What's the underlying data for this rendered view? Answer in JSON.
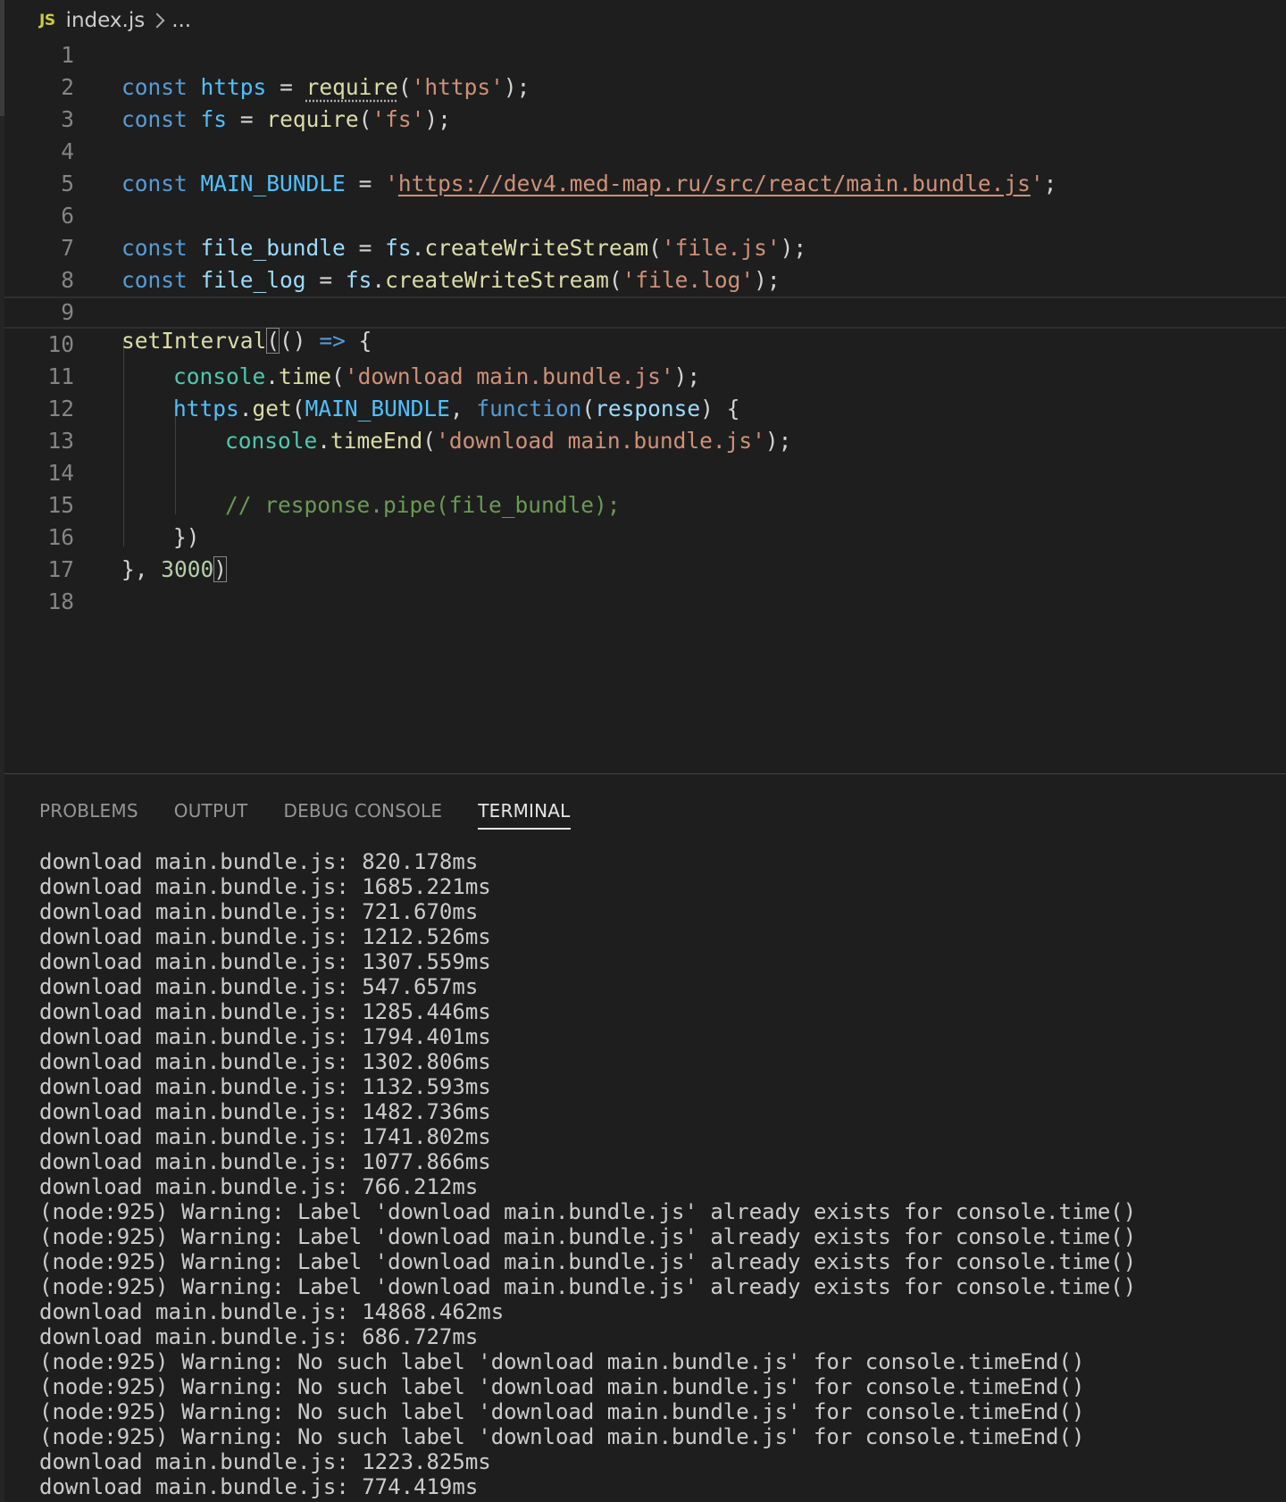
{
  "breadcrumb": {
    "file_type_icon": "JS",
    "file_name": "index.js",
    "more": "..."
  },
  "editor": {
    "line_numbers": [
      "1",
      "2",
      "3",
      "4",
      "5",
      "6",
      "7",
      "8",
      "9",
      "10",
      "11",
      "12",
      "13",
      "14",
      "15",
      "16",
      "17",
      "18"
    ],
    "line1": {
      "kw": "const",
      "name": "https",
      "eq": "=",
      "fn": "require",
      "open": "(",
      "str": "'https'",
      "close": ");"
    },
    "line2": {
      "kw": "const",
      "name": "fs",
      "eq": "=",
      "fn": "require",
      "open": "(",
      "str": "'fs'",
      "close": ");"
    },
    "line4": {
      "kw": "const",
      "name": "MAIN_BUNDLE",
      "eq": "=",
      "quote_open": "'",
      "url": "https://dev4.med-map.ru/src/react/main.bundle.js",
      "quote_close": "'",
      "end": ";"
    },
    "line6": {
      "kw": "const",
      "name": "file_bundle",
      "eq": "=",
      "obj": "fs",
      "dot": ".",
      "fn": "createWriteStream",
      "open": "(",
      "str": "'file.js'",
      "close": ");"
    },
    "line7": {
      "kw": "const",
      "name": "file_log",
      "eq": "=",
      "obj": "fs",
      "dot": ".",
      "fn": "createWriteStream",
      "open": "(",
      "str": "'file.log'",
      "close": ");"
    },
    "line9": {
      "fn": "setInterval",
      "open": "(",
      "params": "()",
      "arrow": "=>",
      "brace": "{"
    },
    "line10": {
      "obj": "console",
      "dot": ".",
      "fn": "time",
      "open": "(",
      "str": "'download main.bundle.js'",
      "close": ");"
    },
    "line11": {
      "obj": "https",
      "dot": ".",
      "fn": "get",
      "open": "(",
      "arg": "MAIN_BUNDLE",
      "comma": ",",
      "kw": "function",
      "popen": "(",
      "param": "response",
      "pclose": ")",
      "brace": "{"
    },
    "line12": {
      "obj": "console",
      "dot": ".",
      "fn": "timeEnd",
      "open": "(",
      "str": "'download main.bundle.js'",
      "close": ");"
    },
    "line14": {
      "comment": "// response.pipe(file_bundle);"
    },
    "line15": {
      "text": "})"
    },
    "line16": {
      "close": "},",
      "num": "3000",
      "paren": ")"
    }
  },
  "panel": {
    "tabs": [
      {
        "label": "PROBLEMS",
        "active": false
      },
      {
        "label": "OUTPUT",
        "active": false
      },
      {
        "label": "DEBUG CONSOLE",
        "active": false
      },
      {
        "label": "TERMINAL",
        "active": true
      }
    ],
    "terminal_lines": [
      "download main.bundle.js: 820.178ms",
      "download main.bundle.js: 1685.221ms",
      "download main.bundle.js: 721.670ms",
      "download main.bundle.js: 1212.526ms",
      "download main.bundle.js: 1307.559ms",
      "download main.bundle.js: 547.657ms",
      "download main.bundle.js: 1285.446ms",
      "download main.bundle.js: 1794.401ms",
      "download main.bundle.js: 1302.806ms",
      "download main.bundle.js: 1132.593ms",
      "download main.bundle.js: 1482.736ms",
      "download main.bundle.js: 1741.802ms",
      "download main.bundle.js: 1077.866ms",
      "download main.bundle.js: 766.212ms",
      "(node:925) Warning: Label 'download main.bundle.js' already exists for console.time()",
      "(node:925) Warning: Label 'download main.bundle.js' already exists for console.time()",
      "(node:925) Warning: Label 'download main.bundle.js' already exists for console.time()",
      "(node:925) Warning: Label 'download main.bundle.js' already exists for console.time()",
      "download main.bundle.js: 14868.462ms",
      "download main.bundle.js: 686.727ms",
      "(node:925) Warning: No such label 'download main.bundle.js' for console.timeEnd()",
      "(node:925) Warning: No such label 'download main.bundle.js' for console.timeEnd()",
      "(node:925) Warning: No such label 'download main.bundle.js' for console.timeEnd()",
      "(node:925) Warning: No such label 'download main.bundle.js' for console.timeEnd()",
      "download main.bundle.js: 1223.825ms",
      "download main.bundle.js: 774.419ms"
    ]
  },
  "colors": {
    "background": "#1e1e1e",
    "keyword": "#569cd6",
    "variable": "#9cdcfe",
    "function": "#dcdcaa",
    "string": "#ce9178",
    "class": "#4ec9b0",
    "number": "#b5cea8",
    "comment": "#6a9955",
    "js_icon": "#cbcb41"
  }
}
